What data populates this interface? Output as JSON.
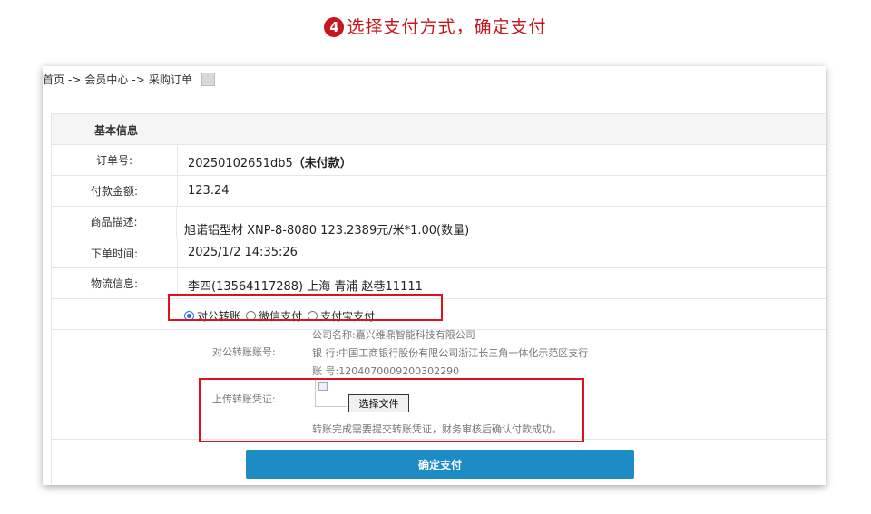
{
  "step": {
    "number": "4",
    "title": "选择支付方式，确定支付"
  },
  "breadcrumb": {
    "home": "首页",
    "separator1": "->",
    "member": "会员中心",
    "separator2": "->",
    "current": "采购订单"
  },
  "section": {
    "title": "基本信息"
  },
  "order": {
    "order_no_label": "订单号:",
    "order_no_value": "20250102651db5",
    "order_status": "（未付款）",
    "amount_label": "付款金额:",
    "amount_value": "123.24",
    "desc_label": "商品描述:",
    "desc_value": "旭诺铝型材 XNP-8-8080  123.2389元/米*1.00(数量)",
    "time_label": "下单时间:",
    "time_value": "2025/1/2 14:35:26",
    "logistics_label": "物流信息:",
    "logistics_value": "李四(13564117288) 上海 青浦 赵巷11111"
  },
  "payment": {
    "options": [
      "对公转账",
      "微信支付",
      "支付宝支付"
    ],
    "selected": "对公转账"
  },
  "transfer": {
    "account_label": "对公转账账号:",
    "company": "公司名称:嘉兴维鼎智能科技有限公司",
    "bank": "银 行:中国工商银行股份有限公司浙江长三角一体化示范区支行",
    "account": "账 号:1204070009200302290",
    "upload_label": "上传转账凭证:",
    "choose_file": "选择文件",
    "hint": "转账完成需要提交转账凭证，财务审核后确认付款成功。"
  },
  "confirm_button": "确定支付",
  "colors": {
    "accent_red": "#e0101c",
    "button_blue": "#1d8bc4",
    "radio_blue": "#1a73e8"
  }
}
